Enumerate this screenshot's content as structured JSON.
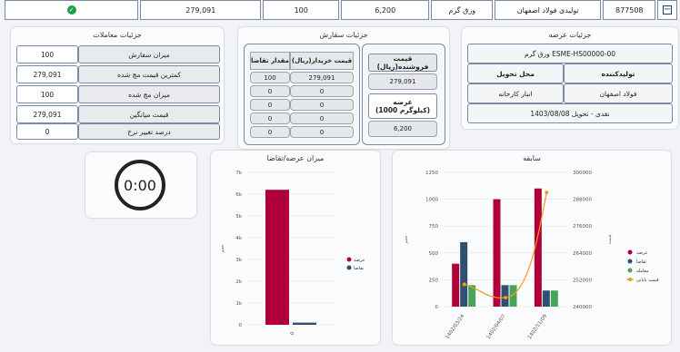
{
  "topbar": {
    "cells": [
      "877508",
      "تولیدی فولاد اصفهان",
      "ورق گرم",
      "6,200",
      "100",
      "279,091"
    ]
  },
  "offer": {
    "title": "جزئیات عرضه",
    "code": "ورق گرم ESME-HS00000-00",
    "producer_label": "تولیدکننده",
    "place_label": "محل تحویل",
    "producer": "فولاد اصفهان",
    "place": "انبار کارخانه",
    "payment": "نقدی - تحویل 1403/08/08"
  },
  "order": {
    "title": "جزئیات سفارش",
    "seller_price_label": "قیمت فروشنده(ریال)",
    "seller_price": "279,091",
    "supply_label": "عرضه\n(1000 کیلوگرم)",
    "supply": "6,200",
    "buy_price_label": "قیمت خریدار(ریال)",
    "demand_label": "مقدار تقاضا",
    "rows": [
      {
        "price": "279,091",
        "qty": "100"
      },
      {
        "price": "0",
        "qty": "0"
      },
      {
        "price": "0",
        "qty": "0"
      },
      {
        "price": "0",
        "qty": "0"
      },
      {
        "price": "0",
        "qty": "0"
      }
    ]
  },
  "trades": {
    "title": "جزئیات معاملات",
    "rows": [
      {
        "label": "میزان سفارش",
        "value": "100"
      },
      {
        "label": "کمترین قیمت مچ شده",
        "value": "279,091"
      },
      {
        "label": "میزان مچ شده",
        "value": "100"
      },
      {
        "label": "قیمت میانگین",
        "value": "279,091"
      },
      {
        "label": "درصد تغییر نرخ",
        "value": "0"
      }
    ]
  },
  "timer": {
    "value": "0:00"
  },
  "colors": {
    "supply": "#b0003a",
    "demand": "#2e5073",
    "trade": "#4aa35a",
    "price": "#f29b1d"
  },
  "chart_data": [
    {
      "type": "bar",
      "title": "میزان عرضه/تقاضا",
      "categories": [
        "0"
      ],
      "series": [
        {
          "name": "عرضه",
          "values": [
            6200
          ]
        },
        {
          "name": "تقاضا",
          "values": [
            100
          ]
        }
      ],
      "ylabel": "حجم",
      "ylim": [
        0,
        7000
      ],
      "yticks": [
        "0",
        "1k",
        "2k",
        "3k",
        "4k",
        "5k",
        "6k",
        "7k"
      ],
      "legend": "right"
    },
    {
      "type": "bar",
      "title": "سابقه",
      "categories": [
        "1402/03/24",
        "1402/04/07",
        "1402/11/09"
      ],
      "series": [
        {
          "name": "عرضه",
          "values": [
            400,
            1000,
            1100
          ]
        },
        {
          "name": "تقاضا",
          "values": [
            600,
            200,
            150
          ]
        },
        {
          "name": "معامله",
          "values": [
            200,
            200,
            150
          ]
        },
        {
          "name": "قیمت پایانی",
          "type": "line",
          "axis": "right",
          "values": [
            250000,
            244000,
            291000
          ]
        }
      ],
      "ylabel": "حجم",
      "y2label": "قیمت",
      "ylim": [
        0,
        1250
      ],
      "y2lim": [
        240000,
        300000
      ],
      "yticks": [
        "0",
        "250",
        "500",
        "750",
        "1000",
        "1250"
      ],
      "y2ticks": [
        "240000",
        "252000",
        "264000",
        "276000",
        "288000",
        "300000"
      ],
      "legend": "right"
    }
  ]
}
